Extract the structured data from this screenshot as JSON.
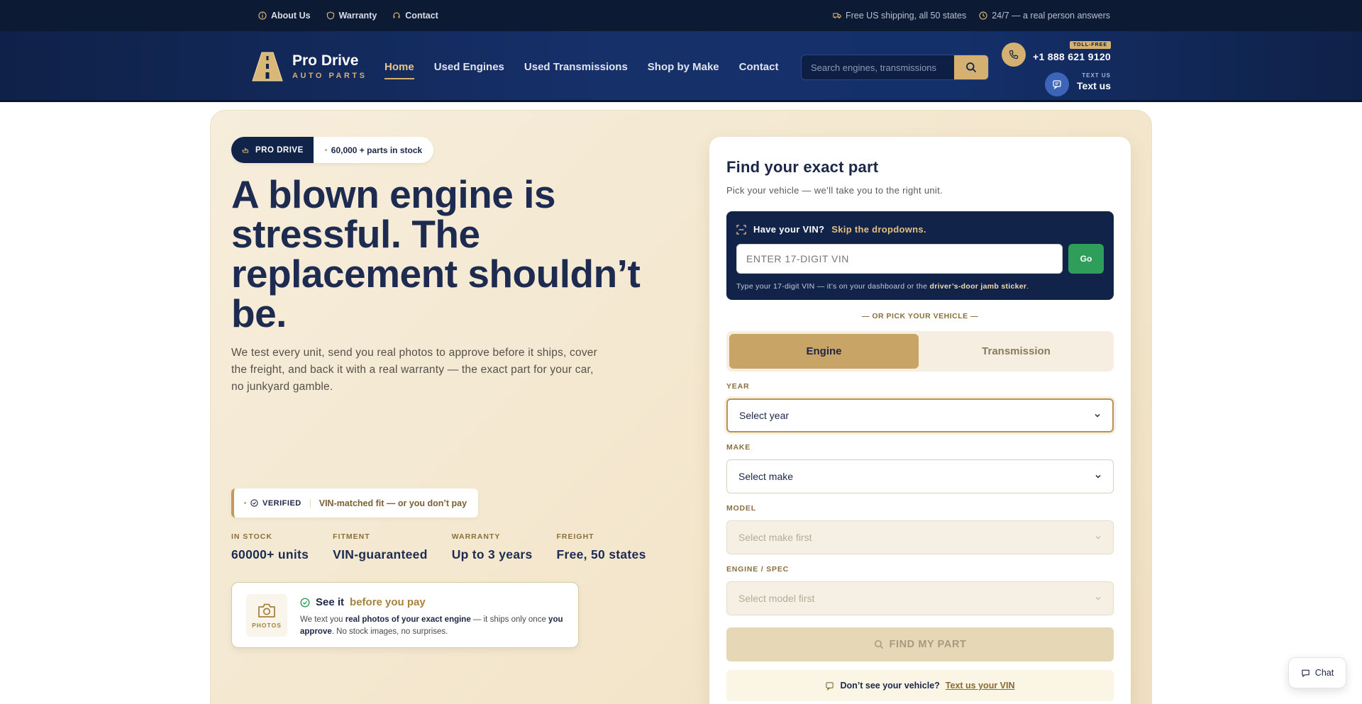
{
  "topbar": {
    "links": [
      {
        "label": "About Us",
        "icon": "info-icon"
      },
      {
        "label": "Warranty",
        "icon": "shield-icon"
      },
      {
        "label": "Contact",
        "icon": "headset-icon"
      }
    ],
    "shipping": "Free US shipping, all 50 states",
    "support": "24/7 — a real person answers"
  },
  "header": {
    "brand": "Pro Drive",
    "brand_sub": "AUTO PARTS",
    "nav": [
      "Home",
      "Used Engines",
      "Used Transmissions",
      "Shop by Make",
      "Contact"
    ],
    "active_nav": "Home",
    "search_placeholder": "Search engines, transmissions",
    "tollfree_badge": "TOLL-FREE",
    "phone": "+1 888 621 9120",
    "textus_small": "TEXT US",
    "textus_label": "Text us"
  },
  "hero": {
    "pill_brand": "PRO DRIVE",
    "pill_stock": "60,000  + parts in stock",
    "headline": "A blown engine is stressful. The replacement shouldn’t be.",
    "lead": "We test every unit, send you real photos to approve before it ships, cover the freight, and back it with a real warranty — the exact part for your car, no junkyard gamble.",
    "verified_tag": "VERIFIED",
    "verified_text": "VIN-matched fit — or you don’t pay",
    "stats": [
      {
        "label": "IN STOCK",
        "value": "60000+ units"
      },
      {
        "label": "FITMENT",
        "value": "VIN-guaranteed"
      },
      {
        "label": "WARRANTY",
        "value": "Up to 3 years"
      },
      {
        "label": "FREIGHT",
        "value": "Free, 50 states"
      }
    ],
    "seeit": {
      "cam_label": "PHOTOS",
      "title": "See it",
      "title_gold": "before you pay",
      "desc_1": "We text you ",
      "desc_b1": "real photos of your exact engine",
      "desc_2": " — it ships only once ",
      "desc_b2": "you approve",
      "desc_3": ". No stock images, no surprises."
    }
  },
  "finder": {
    "title": "Find your exact part",
    "subtitle": "Pick your vehicle — we’ll take you to the right unit.",
    "vin_head": "Have your VIN?",
    "vin_head_gold": "Skip the dropdowns.",
    "vin_placeholder": "ENTER 17-DIGIT VIN",
    "vin_go": "Go",
    "vin_help": "Type your 17-digit VIN — it’s on your dashboard or the ",
    "vin_help_b": "driver’s-door jamb sticker",
    "vin_help_end": ".",
    "or_pick": "— OR PICK YOUR VEHICLE —",
    "tabs": [
      "Engine",
      "Transmission"
    ],
    "active_tab": "Engine",
    "fields": [
      {
        "label": "YEAR",
        "value": "Select year",
        "state": "focus"
      },
      {
        "label": "MAKE",
        "value": "Select make",
        "state": "enabled"
      },
      {
        "label": "MODEL",
        "value": "Select make first",
        "state": "disabled"
      },
      {
        "label": "ENGINE / SPEC",
        "value": "Select model first",
        "state": "disabled"
      }
    ],
    "find_button": "FIND MY PART",
    "dontsee_text": "Don’t see your vehicle?",
    "dontsee_link": "Text us your VIN"
  },
  "chat": {
    "label": "Chat"
  },
  "colors": {
    "navy": "#12234a",
    "gold": "#d4b071",
    "cream": "#f6eddb",
    "green": "#2f9e5b"
  }
}
